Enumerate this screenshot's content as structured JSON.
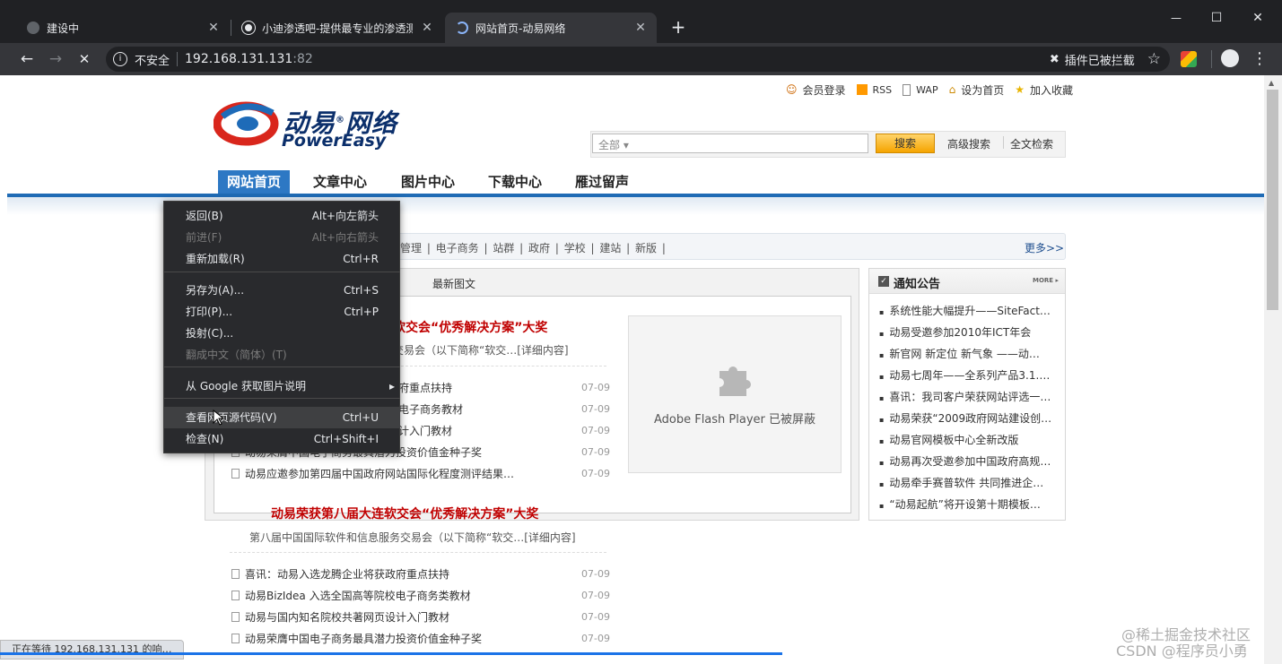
{
  "tabs": [
    {
      "title": "建设中",
      "active": false
    },
    {
      "title": "小迪渗透吧-提供最专业的渗透测",
      "active": false
    },
    {
      "title": "网站首页-动易网络",
      "active": true
    }
  ],
  "new_tab": "+",
  "window": {
    "minimize": "—",
    "maximize": "☐",
    "close": "✕"
  },
  "toolbar": {
    "back": "←",
    "forward": "→",
    "stop": "✕",
    "security": "不安全",
    "url_host": "192.168.131.131",
    "url_port": ":82",
    "blocked": "插件已被拦截",
    "star": "☆",
    "menu": "⋮"
  },
  "site": {
    "toplinks": [
      "会员登录",
      "RSS",
      "WAP",
      "设为首页",
      "加入收藏"
    ],
    "logo_cn": "动易",
    "logo_cn2": "网络",
    "logo_reg": "®",
    "logo_en": "PowerEasy",
    "search_scope": "全部",
    "search_btn": "搜索",
    "adv_search": "高级搜索",
    "full_search": "全文检索",
    "nav": [
      "网站首页",
      "文章中心",
      "图片中心",
      "下载中心",
      "雁过留声"
    ],
    "tags": "管理 | 电子商务 | 站群 | 政府 | 学校 | 建站 | 新版 |",
    "more": "更多>>",
    "tab_latest": "最新图文",
    "headline1": "软交会“优秀解决方案”大奖",
    "sub1": "交易会（以下简称“软交…",
    "detail": "[详细内容]",
    "flash": "Adobe Flash Player 已被屏蔽",
    "headline2": "动易荣获第八届大连软交会“优秀解决方案”大奖",
    "sub2": "第八届中国国际软件和信息服务交易会（以下简称“软交…",
    "list1": [
      {
        "t": "府重点扶持",
        "d": "07-09"
      },
      {
        "t": "电子商务教材",
        "d": "07-09"
      },
      {
        "t": "计入门教材",
        "d": "07-09"
      },
      {
        "t": "动易荣膺中国电子商务最具潜力投资价值金种子奖",
        "d": "07-09"
      },
      {
        "t": "动易应邀参加第四届中国政府网站国际化程度测评结果…",
        "d": "07-09"
      }
    ],
    "list2": [
      {
        "t": "喜讯：动易入选龙腾企业将获政府重点扶持",
        "d": "07-09"
      },
      {
        "t": "动易BizIdea 入选全国高等院校电子商务类教材",
        "d": "07-09"
      },
      {
        "t": "动易与国内知名院校共著网页设计入门教材",
        "d": "07-09"
      },
      {
        "t": "动易荣膺中国电子商务最具潜力投资价值金种子奖",
        "d": "07-09"
      }
    ],
    "notice_title": "通知公告",
    "notice_more": "MORE ▸",
    "notices": [
      "系统性能大幅提升——SiteFact…",
      "动易受邀参加2010年ICT年会",
      "新官网 新定位 新气象 ——动…",
      "动易七周年——全系列产品3.1.…",
      "喜讯：我司客户荣获网站评选一…",
      "动易荣获“2009政府网站建设创…",
      "动易官网模板中心全新改版",
      "动易再次受邀参加中国政府高规…",
      "动易牵手赛普软件 共同推进企…",
      "“动易起航”将开设第十期模板…"
    ]
  },
  "context_menu": {
    "items": [
      {
        "label": "返回(B)",
        "shortcut": "Alt+向左箭头",
        "disabled": false
      },
      {
        "label": "前进(F)",
        "shortcut": "Alt+向右箭头",
        "disabled": true
      },
      {
        "label": "重新加载(R)",
        "shortcut": "Ctrl+R",
        "disabled": false
      },
      {
        "label": "另存为(A)...",
        "shortcut": "Ctrl+S",
        "disabled": false
      },
      {
        "label": "打印(P)...",
        "shortcut": "Ctrl+P",
        "disabled": false
      },
      {
        "label": "投射(C)...",
        "shortcut": "",
        "disabled": false
      },
      {
        "label": "翻成中文（简体）(T)",
        "shortcut": "",
        "disabled": true
      },
      {
        "label": "从 Google 获取图片说明",
        "shortcut": "▸",
        "disabled": false
      },
      {
        "label": "查看网页源代码(V)",
        "shortcut": "Ctrl+U",
        "disabled": false
      },
      {
        "label": "检查(N)",
        "shortcut": "Ctrl+Shift+I",
        "disabled": false
      }
    ]
  },
  "status": "正在等待 192.168.131.131 的响…",
  "watermark": "@稀土掘金技术社区",
  "watermark2": "CSDN @程序员小勇",
  "load_progress": 0.61
}
